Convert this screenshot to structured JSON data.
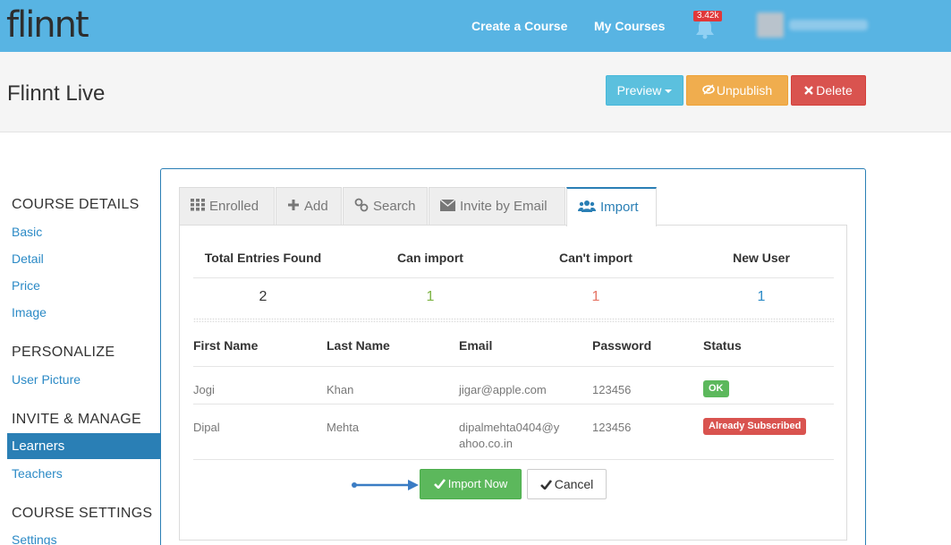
{
  "topbar": {
    "logo": "flinnt",
    "nav_create": "Create a Course",
    "nav_my_courses": "My Courses",
    "notification_count": "3.42k",
    "bg_color": "#58b4e3"
  },
  "header": {
    "title": "Flinnt Live",
    "preview_label": "Preview",
    "unpublish_label": "Unpublish",
    "delete_label": "Delete"
  },
  "sidebar": {
    "sections": [
      {
        "heading": "COURSE DETAILS",
        "items": [
          "Basic",
          "Detail",
          "Price",
          "Image"
        ]
      },
      {
        "heading": "PERSONALIZE",
        "items": [
          "User Picture"
        ]
      },
      {
        "heading": "INVITE & MANAGE",
        "items": [
          "Learners",
          "Teachers"
        ]
      },
      {
        "heading": "COURSE SETTINGS",
        "items": [
          "Settings"
        ]
      }
    ],
    "active_item": "Learners"
  },
  "tabs": [
    {
      "label": "Enrolled",
      "icon": "grid-icon"
    },
    {
      "label": "Add",
      "icon": "plus-icon"
    },
    {
      "label": "Search",
      "icon": "link-icon"
    },
    {
      "label": "Invite by Email",
      "icon": "envelope-icon"
    },
    {
      "label": "Import",
      "icon": "users-icon",
      "active": true
    }
  ],
  "summary": {
    "headers": [
      "Total Entries Found",
      "Can import",
      "Can't import",
      "New User"
    ],
    "values": [
      "2",
      "1",
      "1",
      "1"
    ],
    "colors": [
      "#333333",
      "#7cb342",
      "#e57363",
      "#2a8ac6"
    ]
  },
  "table": {
    "columns": [
      "First Name",
      "Last Name",
      "Email",
      "Password",
      "Status"
    ],
    "rows": [
      {
        "first": "Jogi",
        "last": "Khan",
        "email": "jigar@apple.com",
        "password": "123456",
        "status": "OK"
      },
      {
        "first": "Dipal",
        "last": "Mehta",
        "email": "dipalmehta0404@y",
        "email2": "ahoo.co.in",
        "password": "123456",
        "status": "Already Subscribed"
      }
    ]
  },
  "actions": {
    "import_label": "Import Now",
    "cancel_label": "Cancel"
  }
}
